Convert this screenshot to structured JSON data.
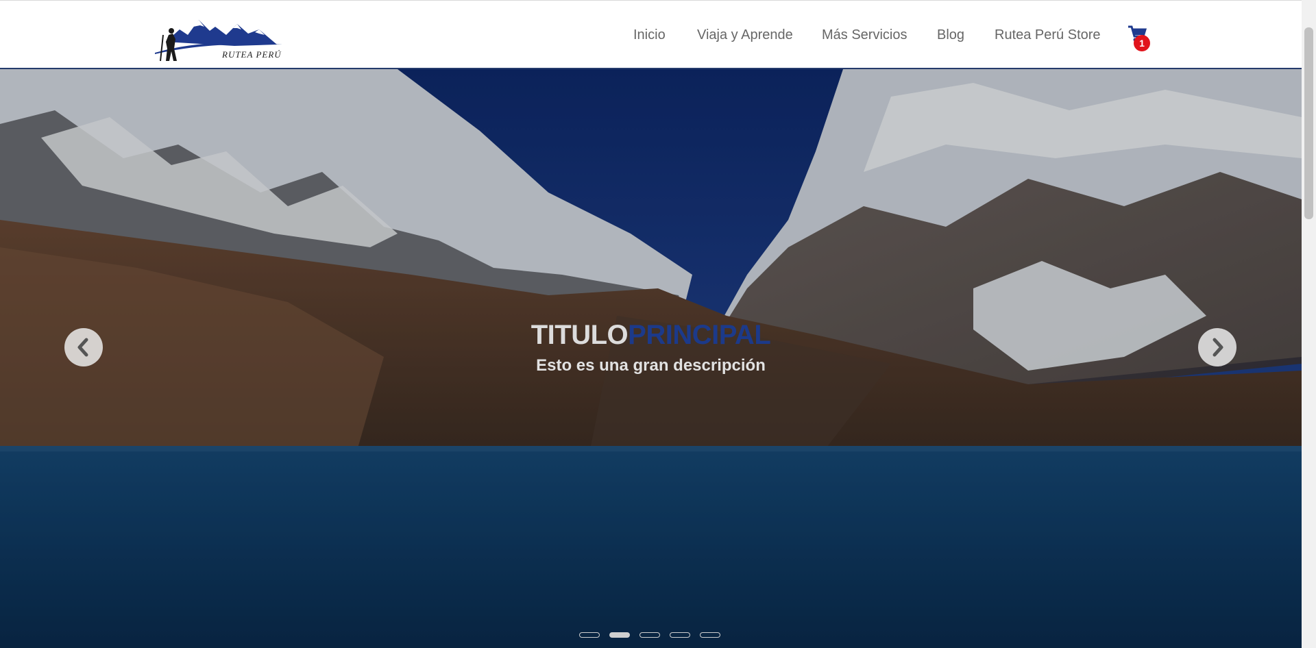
{
  "header": {
    "logo_text": "RUTEA PERÚ",
    "nav": [
      "Inicio",
      "Viaja y Aprende",
      "Más Servicios",
      "Blog",
      "Rutea Perú Store"
    ],
    "cart_count": "1",
    "cart_icon": "shopping-cart-icon"
  },
  "hero": {
    "title_part1": "TITULO",
    "title_part2": "PRINCIPAL",
    "subtitle": "Esto es una gran descripción",
    "prev_icon": "chevron-left-icon",
    "next_icon": "chevron-right-icon",
    "slides_total": 5,
    "active_slide": 2
  },
  "colors": {
    "accent": "#1c3a8a",
    "badge": "#e1141c",
    "nav_text": "#666666"
  }
}
